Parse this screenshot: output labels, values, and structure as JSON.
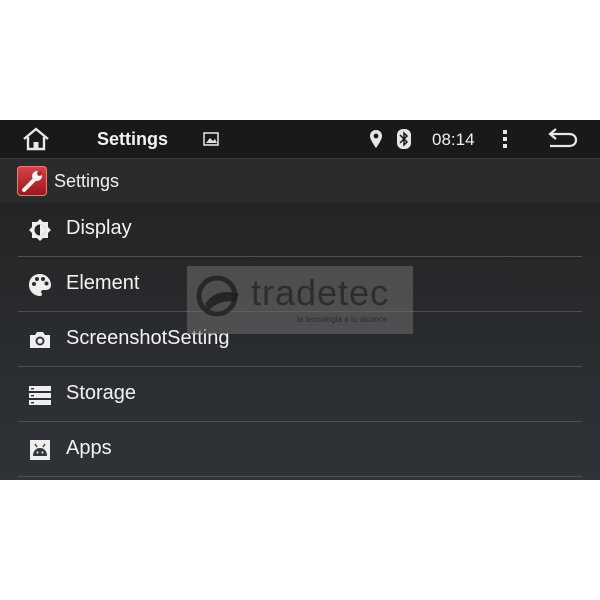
{
  "status_bar": {
    "title": "Settings",
    "time": "08:14",
    "icons": [
      "home-icon",
      "gallery-icon",
      "location-icon",
      "bluetooth-icon",
      "overflow-menu-icon",
      "back-icon"
    ]
  },
  "action_bar": {
    "app_icon": "settings-wrench-icon",
    "label": "Settings"
  },
  "settings_list": [
    {
      "label": "Display",
      "icon": "brightness-icon"
    },
    {
      "label": "Element",
      "icon": "palette-icon"
    },
    {
      "label": "ScreenshotSetting",
      "icon": "camera-icon"
    },
    {
      "label": "Storage",
      "icon": "storage-icon"
    },
    {
      "label": "Apps",
      "icon": "apps-icon"
    }
  ],
  "watermark": {
    "brand": "tradetec",
    "tagline": "la tecnologia a tu alcance"
  },
  "colors": {
    "status_bar_bg": "#191919",
    "action_bar_bg": "#2b2b2b",
    "list_bg": "#2f3338",
    "app_icon_red": "#c0282c"
  }
}
